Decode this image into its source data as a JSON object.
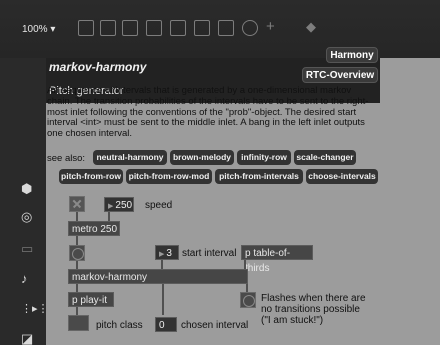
{
  "toolbar": {
    "zoom": "100% ▾",
    "icons": [
      "present-icon",
      "comment-icon",
      "message-icon",
      "close-box-icon",
      "preset-icon",
      "play-icon",
      "minus-box-icon",
      "help-icon",
      "plus-icon",
      "lock-icon"
    ]
  },
  "sidebar": {
    "icons": [
      "package-icon",
      "target-icon",
      "screen-icon",
      "music-note-icon",
      "step-icon",
      "window-icon"
    ]
  },
  "help": {
    "title": "markov-harmony",
    "subtitle": "Pitch generator",
    "harmony_tag": "Harmony",
    "overview_tag": "RTC-Overview",
    "description": "An sequence of intervals that is generated by a one-dimensional markov chain. The transition probabilities of the intervals have to be sent to the right-most inlet following the conventions of the \"prob\"-object. The desired start interval <int> must be sent to the middle inlet. A bang in the left inlet outputs one chosen interval.",
    "see_also_label": "see also:",
    "see_also_row1": [
      "neutral-harmony",
      "brown-melody",
      "infinity-row",
      "scale-changer"
    ],
    "see_also_row2": [
      "pitch-from-row",
      "pitch-from-row-mod",
      "pitch-from-intervals",
      "choose-intervals"
    ]
  },
  "patch": {
    "speed_value": "250",
    "speed_label": "speed",
    "metro": "metro 250",
    "start_value": "3",
    "start_label": "start interval",
    "table_msg": "p table-of-thirds",
    "markov_obj": "markov-harmony",
    "play_obj": "p play-it",
    "pitch_class_label": "pitch class",
    "interval_value": "0",
    "interval_label": "chosen interval",
    "stuck_comment_1": "Flashes when there are",
    "stuck_comment_2": "no transitions possible",
    "stuck_comment_3": "(\"I am stuck!\")"
  }
}
